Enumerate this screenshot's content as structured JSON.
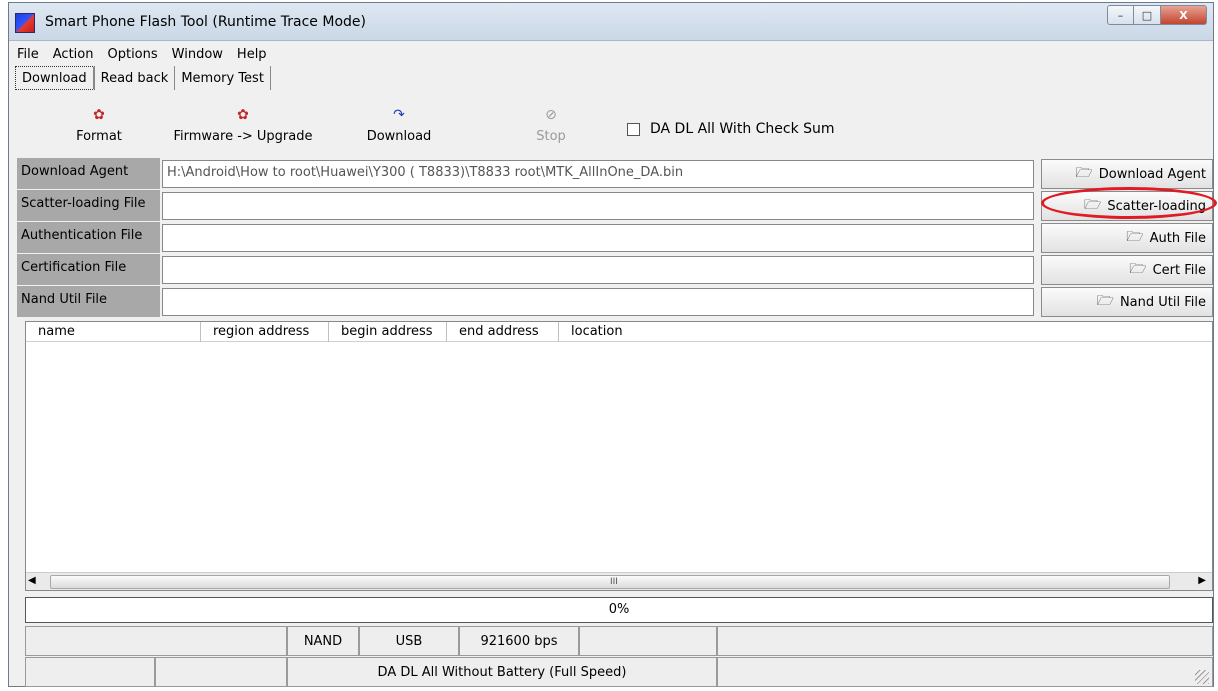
{
  "window": {
    "title": "Smart Phone Flash Tool (Runtime Trace Mode)",
    "controls": {
      "minimize": "–",
      "maximize": "□",
      "close": "X"
    }
  },
  "menu": [
    "File",
    "Action",
    "Options",
    "Window",
    "Help"
  ],
  "tabs": [
    {
      "label": "Download",
      "active": true
    },
    {
      "label": "Read back",
      "active": false
    },
    {
      "label": "Memory Test",
      "active": false
    }
  ],
  "toolbar": {
    "format": "Format",
    "upgrade": "Firmware -> Upgrade",
    "download": "Download",
    "stop": "Stop",
    "checksum_label": "DA DL All With Check Sum",
    "checksum_checked": false
  },
  "files": [
    {
      "label": "Download Agent",
      "value": "H:\\Android\\How to root\\Huawei\\Y300 ( T8833)\\T8833 root\\MTK_AllInOne_DA.bin",
      "button": "Download Agent"
    },
    {
      "label": "Scatter-loading File",
      "value": "",
      "button": "Scatter-loading"
    },
    {
      "label": "Authentication File",
      "value": "",
      "button": "Auth File"
    },
    {
      "label": "Certification File",
      "value": "",
      "button": "Cert File"
    },
    {
      "label": "Nand Util File",
      "value": "",
      "button": "Nand Util File"
    }
  ],
  "table": {
    "columns": [
      "name",
      "region address",
      "begin address",
      "end address",
      "location"
    ],
    "rows": [],
    "scroll_grip": "III"
  },
  "progress": {
    "text": "0%",
    "value": 0
  },
  "status": {
    "storage": "NAND",
    "interface": "USB",
    "baud": "921600 bps",
    "mode": "DA DL All Without Battery (Full Speed)"
  },
  "icons": {
    "app": "flash-tool-icon",
    "folder": "folder-open-icon",
    "stop": "stop-icon"
  }
}
